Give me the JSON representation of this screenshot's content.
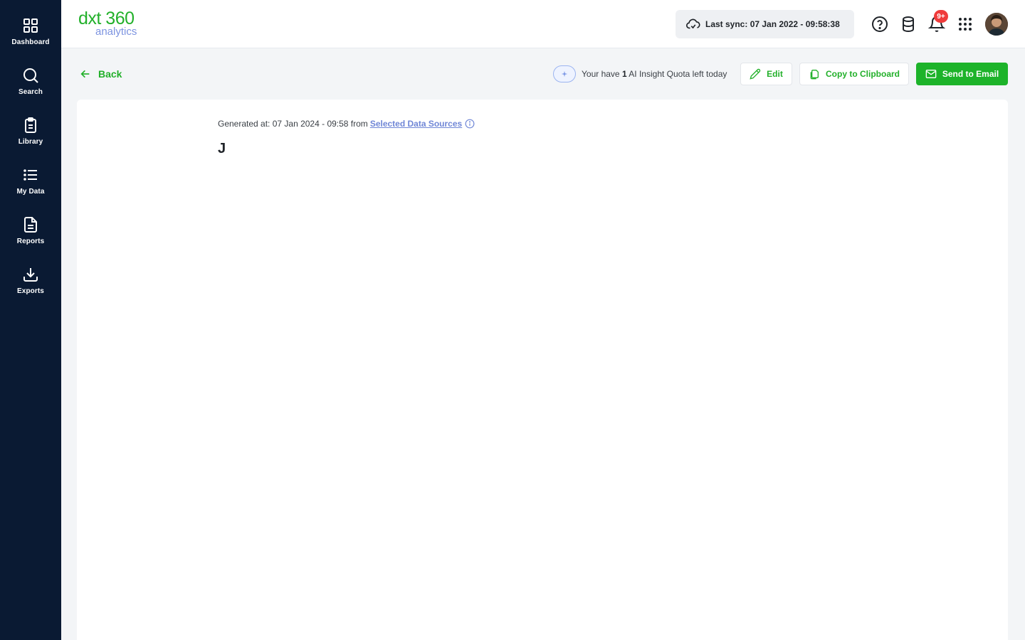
{
  "sidebar": {
    "items": [
      {
        "label": "Dashboard",
        "icon": "dashboard-grid-icon"
      },
      {
        "label": "Search",
        "icon": "search-icon"
      },
      {
        "label": "Library",
        "icon": "clipboard-icon"
      },
      {
        "label": "My Data",
        "icon": "list-icon"
      },
      {
        "label": "Reports",
        "icon": "document-icon"
      },
      {
        "label": "Exports",
        "icon": "download-icon"
      }
    ]
  },
  "header": {
    "logo_top": "dxt 360",
    "logo_bottom": "analytics",
    "sync_text": "Last sync: 07 Jan 2022 - 09:58:38",
    "notification_badge": "9+",
    "icons": [
      "help-icon",
      "database-icon",
      "bell-icon",
      "apps-grid-icon"
    ]
  },
  "actions": {
    "back_label": "Back",
    "quota_prefix": "Your have ",
    "quota_count": "1",
    "quota_suffix": " AI Insight Quota left today",
    "edit_label": "Edit",
    "copy_label": "Copy to Clipboard",
    "email_label": "Send to Email"
  },
  "content": {
    "generated_prefix": "Generated at: 07 Jan 2024 - 09:58 from",
    "sources_link": "Selected Data Sources",
    "body_text": "J"
  },
  "colors": {
    "sidebar_bg": "#0a1a33",
    "accent_green": "#22b02a",
    "link_blue": "#6f86d6",
    "badge_red": "#ef3b3b"
  }
}
